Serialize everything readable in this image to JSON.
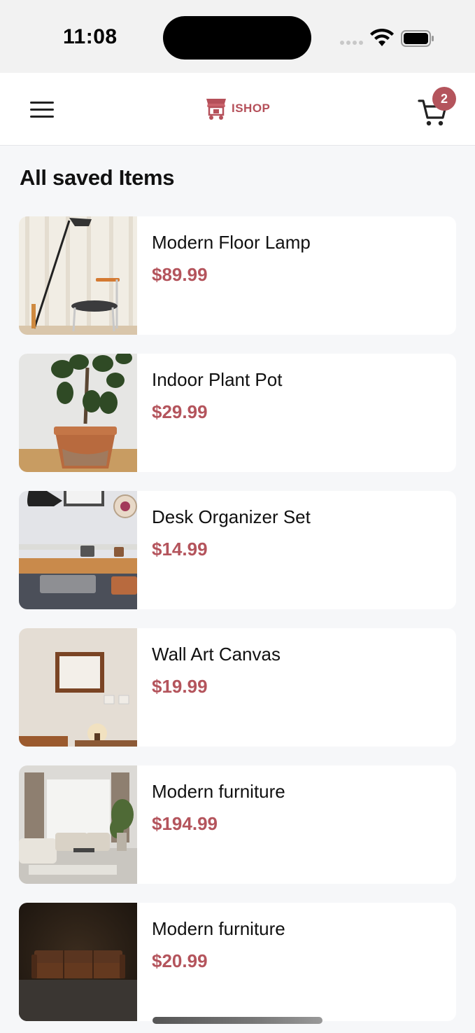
{
  "status_bar": {
    "time": "11:08"
  },
  "header": {
    "logo_text": "ISHOP",
    "cart_count": "2"
  },
  "page": {
    "title": "All saved Items"
  },
  "items": [
    {
      "name": "Modern Floor Lamp",
      "price": "$89.99"
    },
    {
      "name": "Indoor Plant Pot",
      "price": "$29.99"
    },
    {
      "name": "Desk Organizer Set",
      "price": "$14.99"
    },
    {
      "name": "Wall Art Canvas",
      "price": "$19.99"
    },
    {
      "name": "Modern furniture",
      "price": "$194.99"
    },
    {
      "name": "Modern furniture",
      "price": "$20.99"
    }
  ],
  "colors": {
    "accent": "#b4545c",
    "background": "#f6f7f9",
    "card": "#ffffff"
  }
}
